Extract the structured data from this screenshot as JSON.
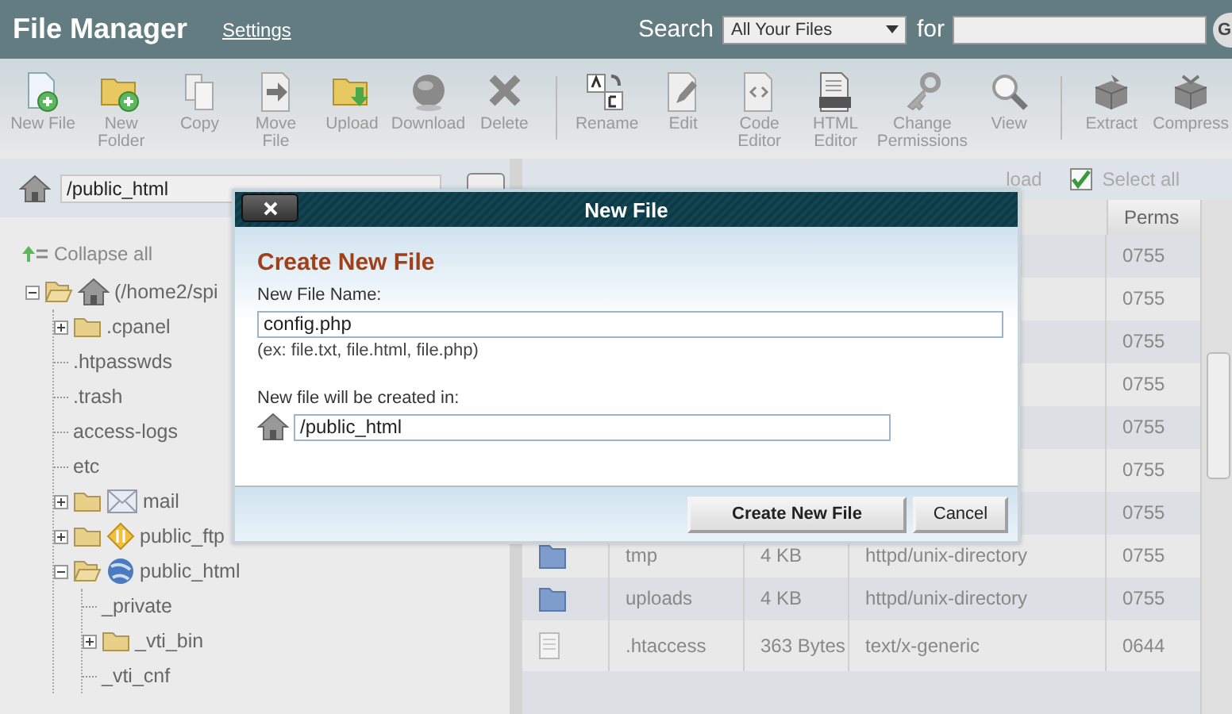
{
  "header": {
    "title": "File Manager",
    "settings_link": "Settings",
    "search_label": "Search",
    "search_scope": "All Your Files",
    "for_label": "for",
    "go_button": "G"
  },
  "toolbar": {
    "groups": [
      [
        {
          "label": "New File"
        },
        {
          "label": "New Folder"
        },
        {
          "label": "Copy"
        },
        {
          "label": "Move File"
        },
        {
          "label": "Upload"
        },
        {
          "label": "Download"
        },
        {
          "label": "Delete"
        }
      ],
      [
        {
          "label": "Rename"
        },
        {
          "label": "Edit"
        },
        {
          "label": "Code Editor"
        },
        {
          "label": "HTML Editor"
        },
        {
          "label": "Change Permissions"
        },
        {
          "label": "View"
        }
      ],
      [
        {
          "label": "Extract"
        },
        {
          "label": "Compress"
        }
      ]
    ]
  },
  "sidebar": {
    "path": "/public_html",
    "collapse_all": "Collapse all",
    "tree": [
      {
        "label": "(/home2/spi",
        "kind": "home",
        "expanded": true,
        "children": [
          {
            "label": ".cpanel",
            "kind": "folder",
            "expanded": false
          },
          {
            "label": ".htpasswds",
            "kind": "item"
          },
          {
            "label": ".trash",
            "kind": "item"
          },
          {
            "label": "access-logs",
            "kind": "item"
          },
          {
            "label": "etc",
            "kind": "item"
          },
          {
            "label": "mail",
            "kind": "mail",
            "expanded": false
          },
          {
            "label": "public_ftp",
            "kind": "ftp",
            "expanded": false
          },
          {
            "label": "public_html",
            "kind": "web",
            "expanded": true,
            "children": [
              {
                "label": "_private",
                "kind": "item"
              },
              {
                "label": "_vti_bin",
                "kind": "folder",
                "expanded": false
              },
              {
                "label": "_vti_cnf",
                "kind": "item"
              }
            ]
          }
        ]
      }
    ]
  },
  "file_list": {
    "reload_label": "load",
    "select_all": {
      "label": "Select all",
      "checked": true
    },
    "columns": [
      {
        "label": "Perms"
      }
    ],
    "rows": [
      {
        "perms": "0755"
      },
      {
        "perms": "0755"
      },
      {
        "perms": "0755"
      },
      {
        "perms": "0755"
      },
      {
        "perms": "0755"
      },
      {
        "perms": "0755"
      },
      {
        "perms": "0755"
      },
      {
        "kind": "folder",
        "name": "tmp",
        "size": "4 KB",
        "type": "httpd/unix-directory",
        "perms": "0755"
      },
      {
        "kind": "folder",
        "name": "uploads",
        "size": "4 KB",
        "type": "httpd/unix-directory",
        "perms": "0755"
      },
      {
        "kind": "file",
        "name": ".htaccess",
        "size": "363 Bytes",
        "type": "text/x-generic",
        "perms": "0644"
      }
    ]
  },
  "dialog": {
    "title": "New File",
    "heading": "Create New File",
    "name_label": "New File Name:",
    "name_value": "config.php",
    "hint": "(ex: file.txt, file.html, file.php)",
    "location_label": "New file will be created in:",
    "location_value": "/public_html",
    "buttons": [
      {
        "label": "Create New File",
        "kind": "primary"
      },
      {
        "label": "Cancel",
        "kind": "secondary"
      }
    ]
  }
}
